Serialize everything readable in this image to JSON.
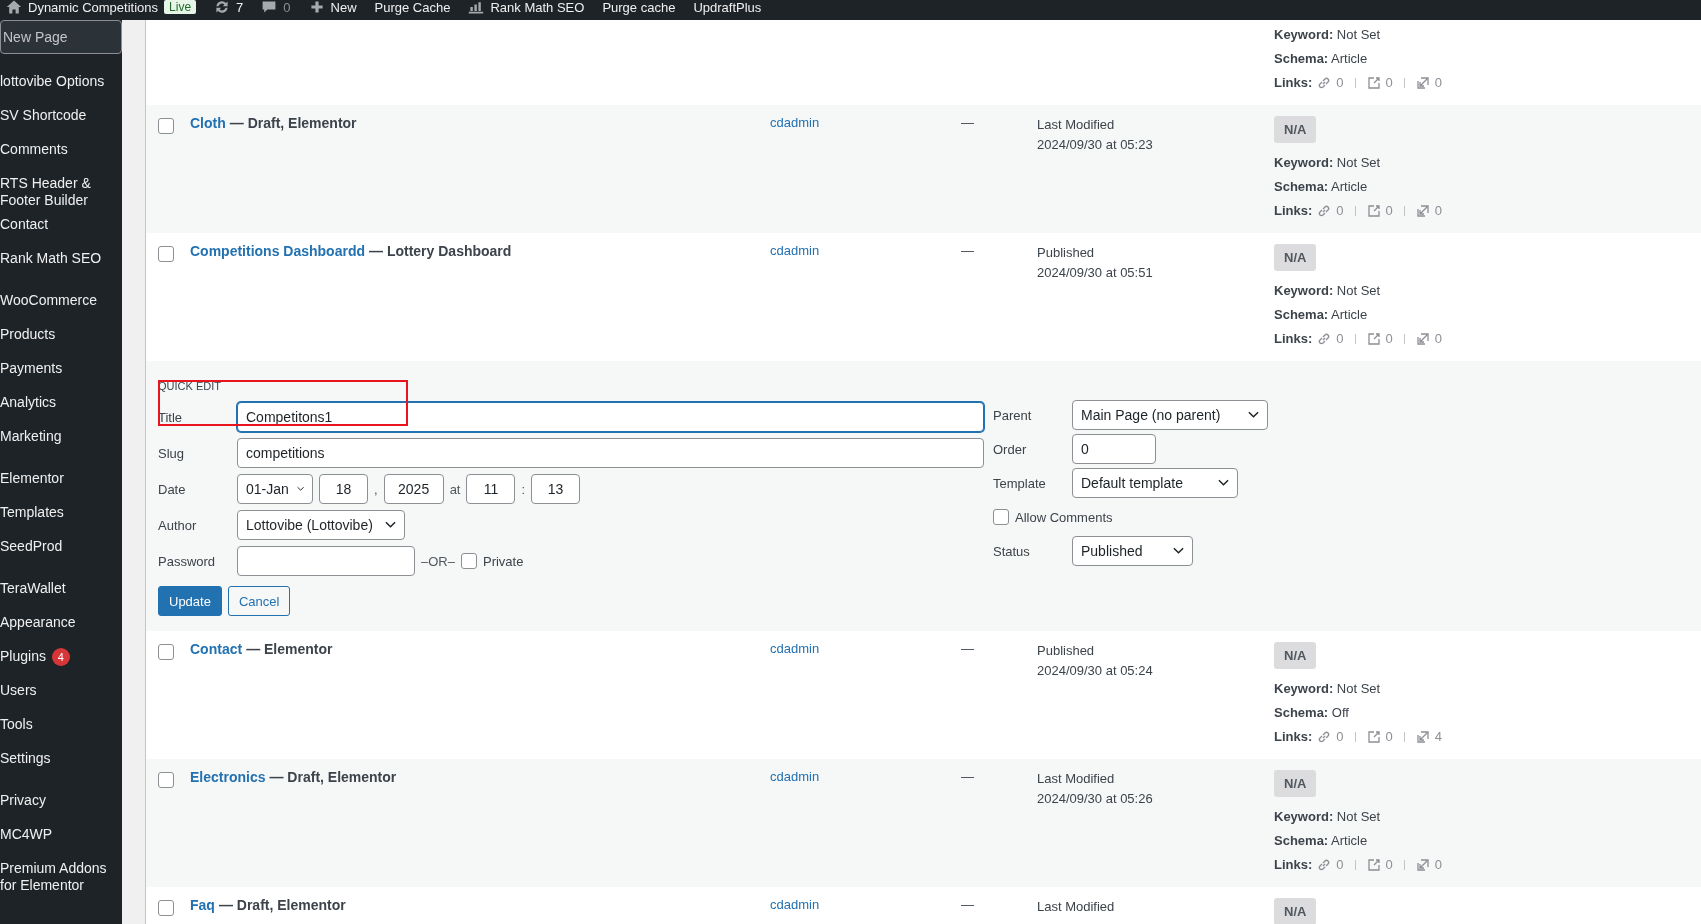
{
  "admin_bar": {
    "site": "Dynamic Competitions",
    "badge": "Live",
    "updates": "7",
    "comments": "0",
    "new": "New",
    "purge_cache": "Purge Cache",
    "seo": "Rank Math SEO",
    "purge_cache_2": "Purge cache",
    "updraft": "UpdraftPlus"
  },
  "sidebar": {
    "groups": [
      {
        "items": [
          {
            "label": "New Page",
            "selected": true
          }
        ]
      },
      {
        "items": [
          {
            "label": "lottovibe Options",
            "selected": false
          },
          {
            "label": "SV Shortcode",
            "selected": false
          },
          {
            "label": "Comments",
            "selected": false
          },
          {
            "label": "RTS Header & Footer Builder",
            "selected": false
          },
          {
            "label": "Contact",
            "selected": false
          },
          {
            "label": "Rank Math SEO",
            "selected": false
          }
        ]
      },
      {
        "items": [
          {
            "label": "WooCommerce",
            "selected": false
          },
          {
            "label": "Products",
            "selected": false
          },
          {
            "label": "Payments",
            "selected": false
          },
          {
            "label": "Analytics",
            "selected": false
          },
          {
            "label": "Marketing",
            "selected": false
          }
        ]
      },
      {
        "items": [
          {
            "label": "Elementor",
            "selected": false
          },
          {
            "label": "Templates",
            "selected": false
          },
          {
            "label": "SeedProd",
            "selected": false
          }
        ]
      },
      {
        "items": [
          {
            "label": "TeraWallet",
            "selected": false
          },
          {
            "label": "Appearance",
            "selected": false
          },
          {
            "label": "Plugins",
            "selected": false,
            "badge": "4"
          },
          {
            "label": "Users",
            "selected": false
          },
          {
            "label": "Tools",
            "selected": false
          },
          {
            "label": "Settings",
            "selected": false
          }
        ]
      },
      {
        "items": [
          {
            "label": "Privacy",
            "selected": false
          },
          {
            "label": "MC4WP",
            "selected": false
          },
          {
            "label": "Premium Addons for Elementor",
            "selected": false
          }
        ]
      }
    ]
  },
  "rows_before": [
    {
      "kind": "partial",
      "seo": {
        "keyword_label": "Keyword:",
        "keyword": "Not Set",
        "schema_label": "Schema:",
        "schema": "Article",
        "links_label": "Links:",
        "internal": "0",
        "external": "0",
        "incoming": "0"
      }
    },
    {
      "kind": "post",
      "checked": false,
      "title": "Cloth",
      "state": "— Draft, Elementor",
      "author": "cdadmin",
      "comments": "—",
      "date_status": "Last Modified",
      "date": "2024/09/30 at 05:23",
      "seo": {
        "score": "N/A",
        "keyword_label": "Keyword:",
        "keyword": "Not Set",
        "schema_label": "Schema:",
        "schema": "Article",
        "links_label": "Links:",
        "internal": "0",
        "external": "0",
        "incoming": "0"
      }
    },
    {
      "kind": "post",
      "checked": false,
      "title": "Competitions Dashboardd",
      "state": "— Lottery Dashboard",
      "author": "cdadmin",
      "comments": "—",
      "date_status": "Published",
      "date": "2024/09/30 at 05:51",
      "seo": {
        "score": "N/A",
        "keyword_label": "Keyword:",
        "keyword": "Not Set",
        "schema_label": "Schema:",
        "schema": "Article",
        "links_label": "Links:",
        "internal": "0",
        "external": "0",
        "incoming": "0"
      }
    }
  ],
  "quick_edit": {
    "heading": "QUICK EDIT",
    "title_highlighted": true,
    "title_label": "Title",
    "title": "Competitons1",
    "slug_label": "Slug",
    "slug": "competitions",
    "date_label": "Date",
    "month": "01-Jan",
    "day": "18",
    "comma": ",",
    "year": "2025",
    "at": "at",
    "hour": "11",
    "colon": ":",
    "minute": "13",
    "author_label": "Author",
    "author": "Lottovibe (Lottovibe)",
    "password_label": "Password",
    "or": "–OR–",
    "private_label": "Private",
    "private_checked": false,
    "update": "Update",
    "cancel": "Cancel",
    "parent_label": "Parent",
    "parent": "Main Page (no parent)",
    "order_label": "Order",
    "order": "0",
    "template_label": "Template",
    "template": "Default template",
    "allow_comments_label": "Allow Comments",
    "allow_comments": false,
    "status_label": "Status",
    "status": "Published"
  },
  "rows_after": [
    {
      "kind": "post",
      "checked": false,
      "title": "Contact",
      "state": "— Elementor",
      "author": "cdadmin",
      "comments": "—",
      "date_status": "Published",
      "date": "2024/09/30 at 05:24",
      "seo": {
        "score": "N/A",
        "keyword_label": "Keyword:",
        "keyword": "Not Set",
        "schema_label": "Schema:",
        "schema": "Off",
        "links_label": "Links:",
        "internal": "0",
        "external": "0",
        "incoming": "4"
      }
    },
    {
      "kind": "post",
      "checked": false,
      "title": "Electronics",
      "state": "— Draft, Elementor",
      "author": "cdadmin",
      "comments": "—",
      "date_status": "Last Modified",
      "date": "2024/09/30 at 05:26",
      "seo": {
        "score": "N/A",
        "keyword_label": "Keyword:",
        "keyword": "Not Set",
        "schema_label": "Schema:",
        "schema": "Article",
        "links_label": "Links:",
        "internal": "0",
        "external": "0",
        "incoming": "0"
      }
    },
    {
      "kind": "post",
      "checked": false,
      "title": "Faq",
      "state": "— Draft, Elementor",
      "author": "cdadmin",
      "comments": "—",
      "date_status": "Last Modified",
      "seo": {
        "score": "N/A"
      }
    }
  ]
}
